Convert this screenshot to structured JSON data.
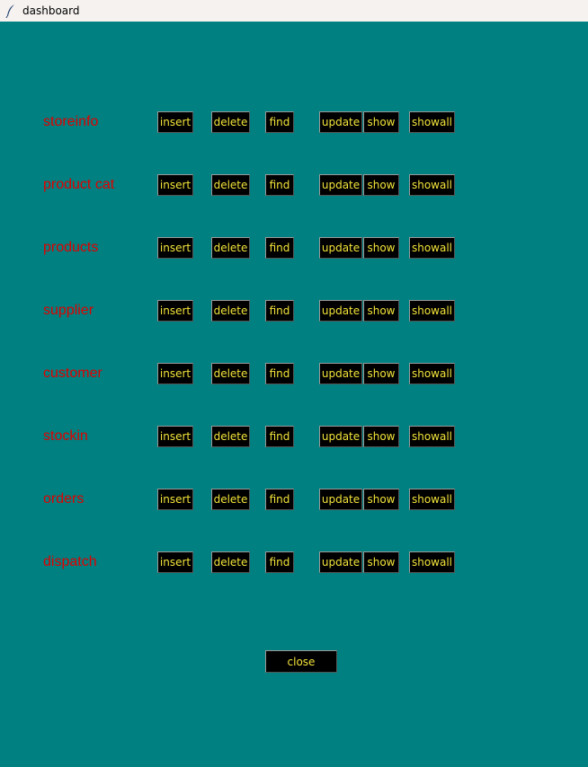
{
  "window": {
    "title": "dashboard",
    "icon": "feather-icon"
  },
  "colors": {
    "background": "#008080",
    "label": "#e00000",
    "button_bg": "#000000",
    "button_text": "#f2e33a"
  },
  "buttons": {
    "insert": "insert",
    "delete": "delete",
    "find": "find",
    "update": "update",
    "show": "show",
    "showall": "showall"
  },
  "rows": [
    {
      "label": "storeinfo"
    },
    {
      "label": "product cat"
    },
    {
      "label": "products"
    },
    {
      "label": "supplier"
    },
    {
      "label": "customer"
    },
    {
      "label": "stockin"
    },
    {
      "label": "orders"
    },
    {
      "label": "dispatch"
    }
  ],
  "close_label": "close"
}
